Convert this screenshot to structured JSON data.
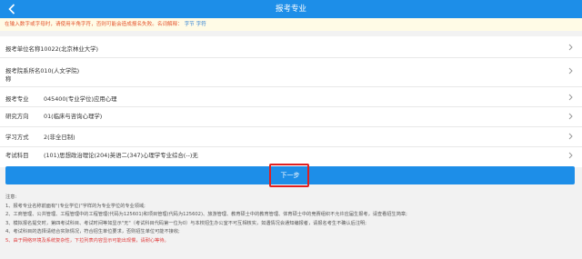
{
  "header": {
    "title": "报考专业",
    "back_icon": "chevron-left-icon"
  },
  "notice": {
    "text": "在输入数字或字母时，请使用半角字符，否则可能会造成报名失败。名词解释：",
    "link": "字节 字符"
  },
  "form": {
    "unit": {
      "text": "报考单位名称10022(北京林业大学)"
    },
    "dept": {
      "line1": "报考院系所名010(人文学院)",
      "line2": "称"
    },
    "major": {
      "label": "报考专业",
      "value": "045400(专业学位)应用心理"
    },
    "direction": {
      "label": "研究方向",
      "value": "01(临床与咨询心理学)"
    },
    "mode": {
      "label": "学习方式",
      "value": "2(非全日制)"
    },
    "subjects": {
      "label": "考试科目",
      "value": "(101)思想政治理论(204)英语二(347)心理学专业综合(--)无"
    }
  },
  "next_button": {
    "label": "下一步"
  },
  "notes": {
    "title": "注意:",
    "items": [
      "1、报考专业名称前面有\"(专业学位)\"字样的为专业学位的专业领域;",
      "2、工商管理、公共管理、工程管理中的工程管理(代码为125601)和项目管理(代码为125602)、旅游管理、教育硕士中的教育管理、体育硕士中的竞赛组织不允许应届生报考，请查看招生简章;",
      "3、模拟报名提交时，第四考试科目、考试时间等如显示\"无\"（考试科目代码第一位为0）与本校招生办公室不可互相核实，如遇情况会通知编报者，请报名考生不确认后注明;",
      "4、考试科目的选择请结合实际情况，符合招生单位要求，否则招生单位可能不接收;",
      "5、由于网络环境及系统复杂性，下拉列表内容显示可能出现慢，请耐心等待。"
    ]
  }
}
